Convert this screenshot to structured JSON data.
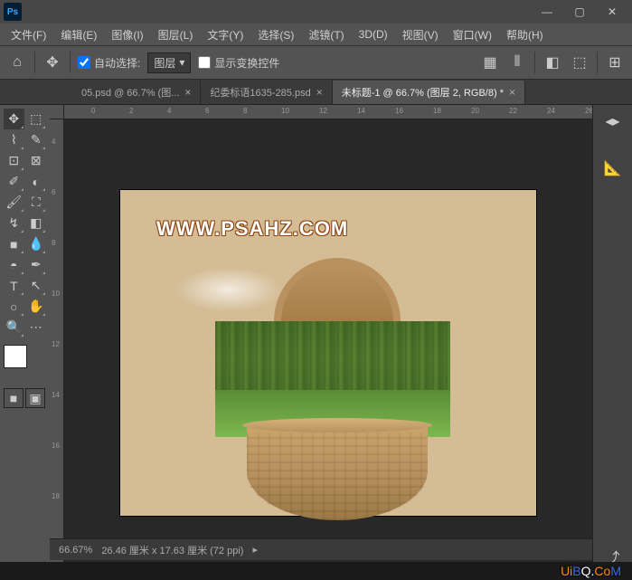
{
  "app": {
    "icon_label": "Ps"
  },
  "menu": {
    "file": "文件(F)",
    "edit": "编辑(E)",
    "image": "图像(I)",
    "layer": "图层(L)",
    "type": "文字(Y)",
    "select": "选择(S)",
    "filter": "滤镜(T)",
    "threeD": "3D(D)",
    "view": "视图(V)",
    "window": "窗口(W)",
    "help": "帮助(H)"
  },
  "options": {
    "auto_select_label": "自动选择:",
    "auto_select_checked": true,
    "auto_select_target": "图层",
    "show_transform_label": "显示变换控件",
    "show_transform_checked": false
  },
  "tabs": [
    {
      "label": "05.psd @ 66.7% (图...",
      "active": false
    },
    {
      "label": "纪委标语1635-285.psd",
      "active": false
    },
    {
      "label": "未标题-1 @ 66.7% (图层 2, RGB/8) *",
      "active": true
    }
  ],
  "ruler_h": [
    "0",
    "2",
    "4",
    "6",
    "8",
    "10",
    "12",
    "14",
    "16",
    "18",
    "20",
    "22",
    "24",
    "26"
  ],
  "ruler_v": [
    "4",
    "6",
    "8",
    "10",
    "12",
    "14",
    "16",
    "18"
  ],
  "canvas_text": "WWW.PSAHZ.COM",
  "status": {
    "zoom": "66.67%",
    "doc_info": "26.46 厘米 x 17.63 厘米 (72 ppi)"
  },
  "watermark": {
    "text": "UiBQ.CoM"
  },
  "icons": {
    "home": "⌂",
    "move": "✥",
    "chevron": "▾",
    "minus": "—",
    "square": "▢",
    "close": "✕",
    "burger": "≡",
    "share": "⤴"
  }
}
